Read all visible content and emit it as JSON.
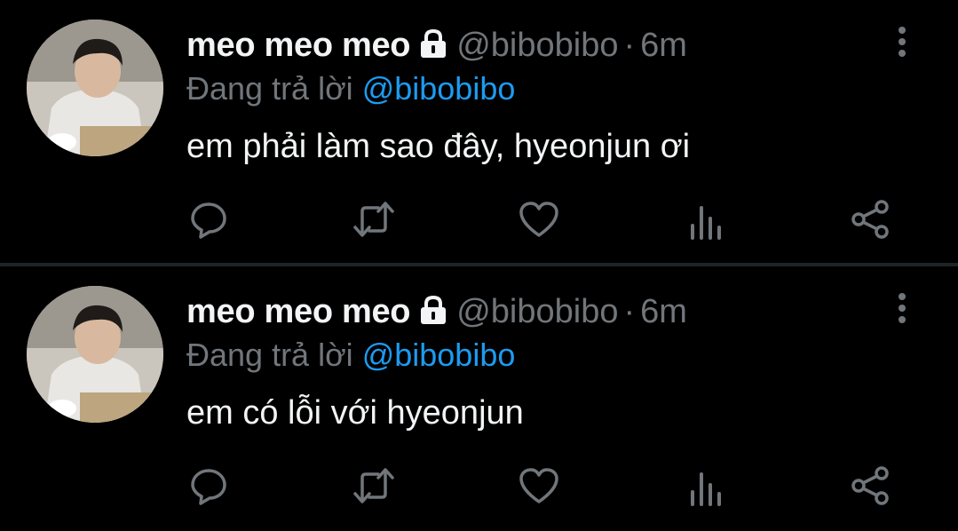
{
  "tweets": [
    {
      "name": "meo meo meo",
      "handle": "@bibobibo",
      "separator": "·",
      "time": "6m",
      "reply_prefix": "Đang trả lời",
      "reply_mention": "@bibobibo",
      "text": "em phải làm sao đây, hyeonjun ơi",
      "icons": [
        "reply-icon",
        "retweet-icon",
        "like-icon",
        "analytics-icon",
        "share-icon"
      ]
    },
    {
      "name": "meo meo meo",
      "handle": "@bibobibo",
      "separator": "·",
      "time": "6m",
      "reply_prefix": "Đang trả lời",
      "reply_mention": "@bibobibo",
      "text": "em có lỗi với hyeonjun",
      "icons": [
        "reply-icon",
        "retweet-icon",
        "like-icon",
        "analytics-icon",
        "share-icon"
      ]
    }
  ],
  "colors": {
    "background": "#000000",
    "text": "#f2f4f5",
    "muted": "#71767b",
    "accent": "#1d9bf0",
    "divider": "#1f2326"
  }
}
